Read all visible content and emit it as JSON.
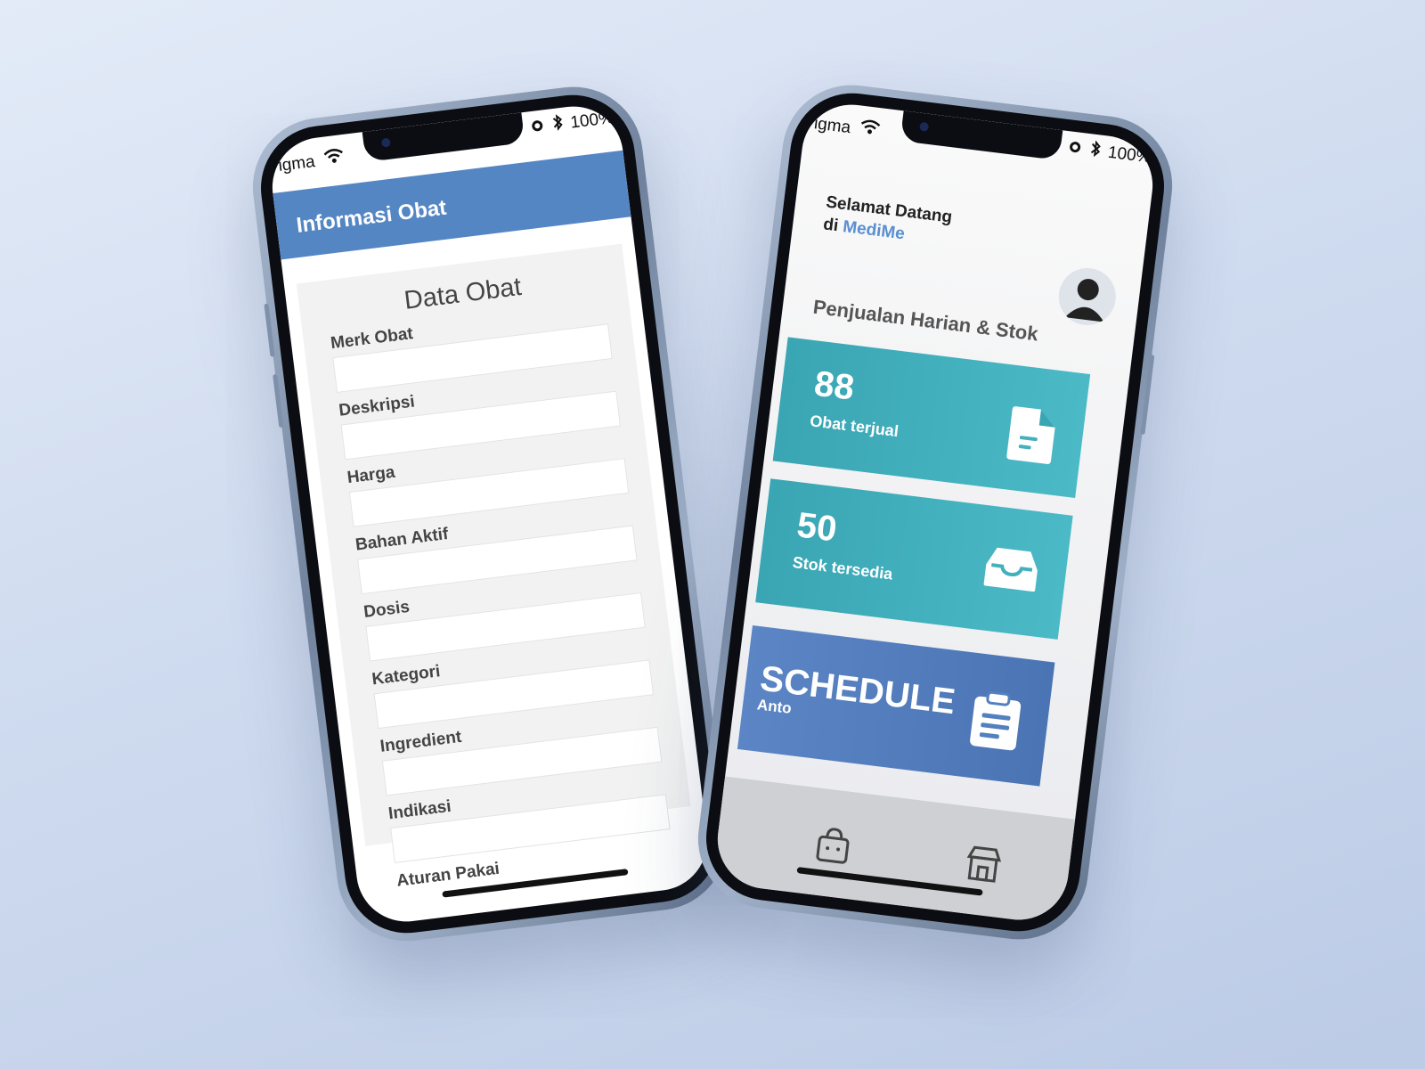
{
  "left_screen": {
    "status": {
      "carrier": "igma",
      "battery": "100%"
    },
    "appbar_title": "Informasi Obat",
    "form_heading": "Data Obat",
    "fields": [
      {
        "label": "Merk Obat",
        "value": ""
      },
      {
        "label": "Deskripsi",
        "value": ""
      },
      {
        "label": "Harga",
        "value": ""
      },
      {
        "label": "Bahan Aktif",
        "value": ""
      },
      {
        "label": "Dosis",
        "value": ""
      },
      {
        "label": "Kategori",
        "value": ""
      },
      {
        "label": "Ingredient",
        "value": ""
      },
      {
        "label": "Indikasi",
        "value": ""
      },
      {
        "label": "Aturan Pakai",
        "value": ""
      }
    ]
  },
  "right_screen": {
    "status": {
      "carrier": "igma",
      "battery": "100%"
    },
    "greeting_line1": "Selamat Datang",
    "greeting_prefix": "di ",
    "brand": "MediMe",
    "section_title": "Penjualan Harian & Stok",
    "cards": [
      {
        "value": "88",
        "label": "Obat terjual",
        "icon": "document-icon"
      },
      {
        "value": "50",
        "label": "Stok tersedia",
        "icon": "inbox-icon"
      }
    ],
    "schedule": {
      "title": "SCHEDULE",
      "subtitle": "Anto",
      "icon": "clipboard-icon"
    },
    "nav": [
      {
        "icon": "shopping-bag-icon"
      },
      {
        "icon": "store-icon"
      }
    ]
  },
  "colors": {
    "appbar": "#5586c4",
    "teal_card": "#42b0bd",
    "blue_card": "#5380bf",
    "brand": "#5a8fd1"
  }
}
